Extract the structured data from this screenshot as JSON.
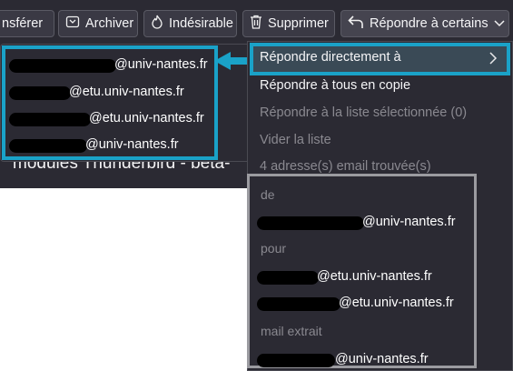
{
  "toolbar": {
    "transfer_label": "nsférer",
    "archive_label": "Archiver",
    "junk_label": "Indésirable",
    "delete_label": "Supprimer",
    "reply_label": "Répondre à certains"
  },
  "message": {
    "subject_fragment": "modules Thunderbird - beta-"
  },
  "left_popup": {
    "addresses": [
      "@univ-nantes.fr",
      "@etu.univ-nantes.fr",
      "@etu.univ-nantes.fr",
      "@univ-nantes.fr"
    ]
  },
  "menu": {
    "items": [
      "Répondre directement à",
      "Répondre à tous en copie",
      "Répondre à la liste sélectionnée (0)",
      "Vider la liste",
      "4 adresse(s) email trouvée(s)"
    ],
    "sections": {
      "from_label": "de",
      "from_address": "@univ-nantes.fr",
      "to_label": "pour",
      "to_addresses": [
        "@etu.univ-nantes.fr",
        "@etu.univ-nantes.fr"
      ],
      "extracted_label": "mail extrait",
      "extracted_address": "@univ-nantes.fr"
    }
  },
  "colors": {
    "highlight_frame": "#1aa2c8",
    "section_frame": "#9b9ba0",
    "background": "#2b2a33"
  }
}
